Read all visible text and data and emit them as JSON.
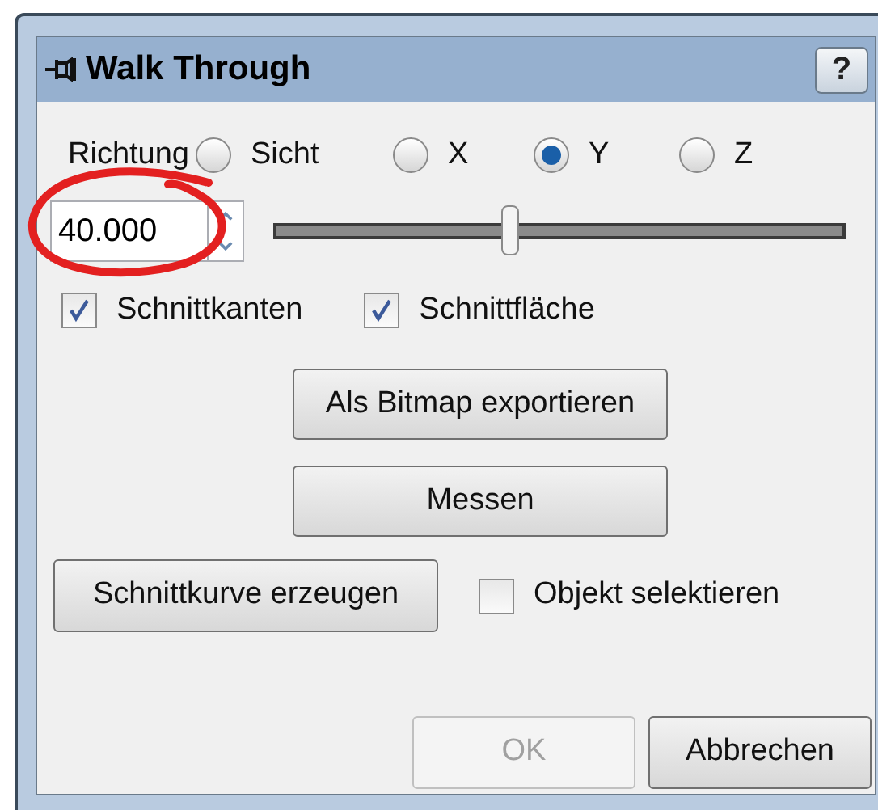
{
  "window": {
    "title": "Walk Through",
    "help": "?"
  },
  "direction": {
    "label": "Richtung",
    "options": [
      {
        "label": "Sicht",
        "selected": false
      },
      {
        "label": "X",
        "selected": false
      },
      {
        "label": "Y",
        "selected": true
      },
      {
        "label": "Z",
        "selected": false
      }
    ]
  },
  "spin": {
    "value": "40.000"
  },
  "slider": {
    "level": 0.415
  },
  "checks": [
    {
      "label": "Schnittkanten",
      "checked": true
    },
    {
      "label": "Schnittfläche",
      "checked": true
    }
  ],
  "buttons": [
    {
      "label": "Als Bitmap exportieren"
    },
    {
      "label": "Messen"
    }
  ],
  "curve_button": {
    "label": "Schnittkurve erzeugen"
  },
  "select_check": {
    "label": "Objekt selektieren",
    "checked": false
  },
  "footer": [
    {
      "label": "OK",
      "disabled": true
    },
    {
      "label": "Abbrechen",
      "disabled": false
    }
  ],
  "annotation": {
    "kind": "ellipse"
  }
}
